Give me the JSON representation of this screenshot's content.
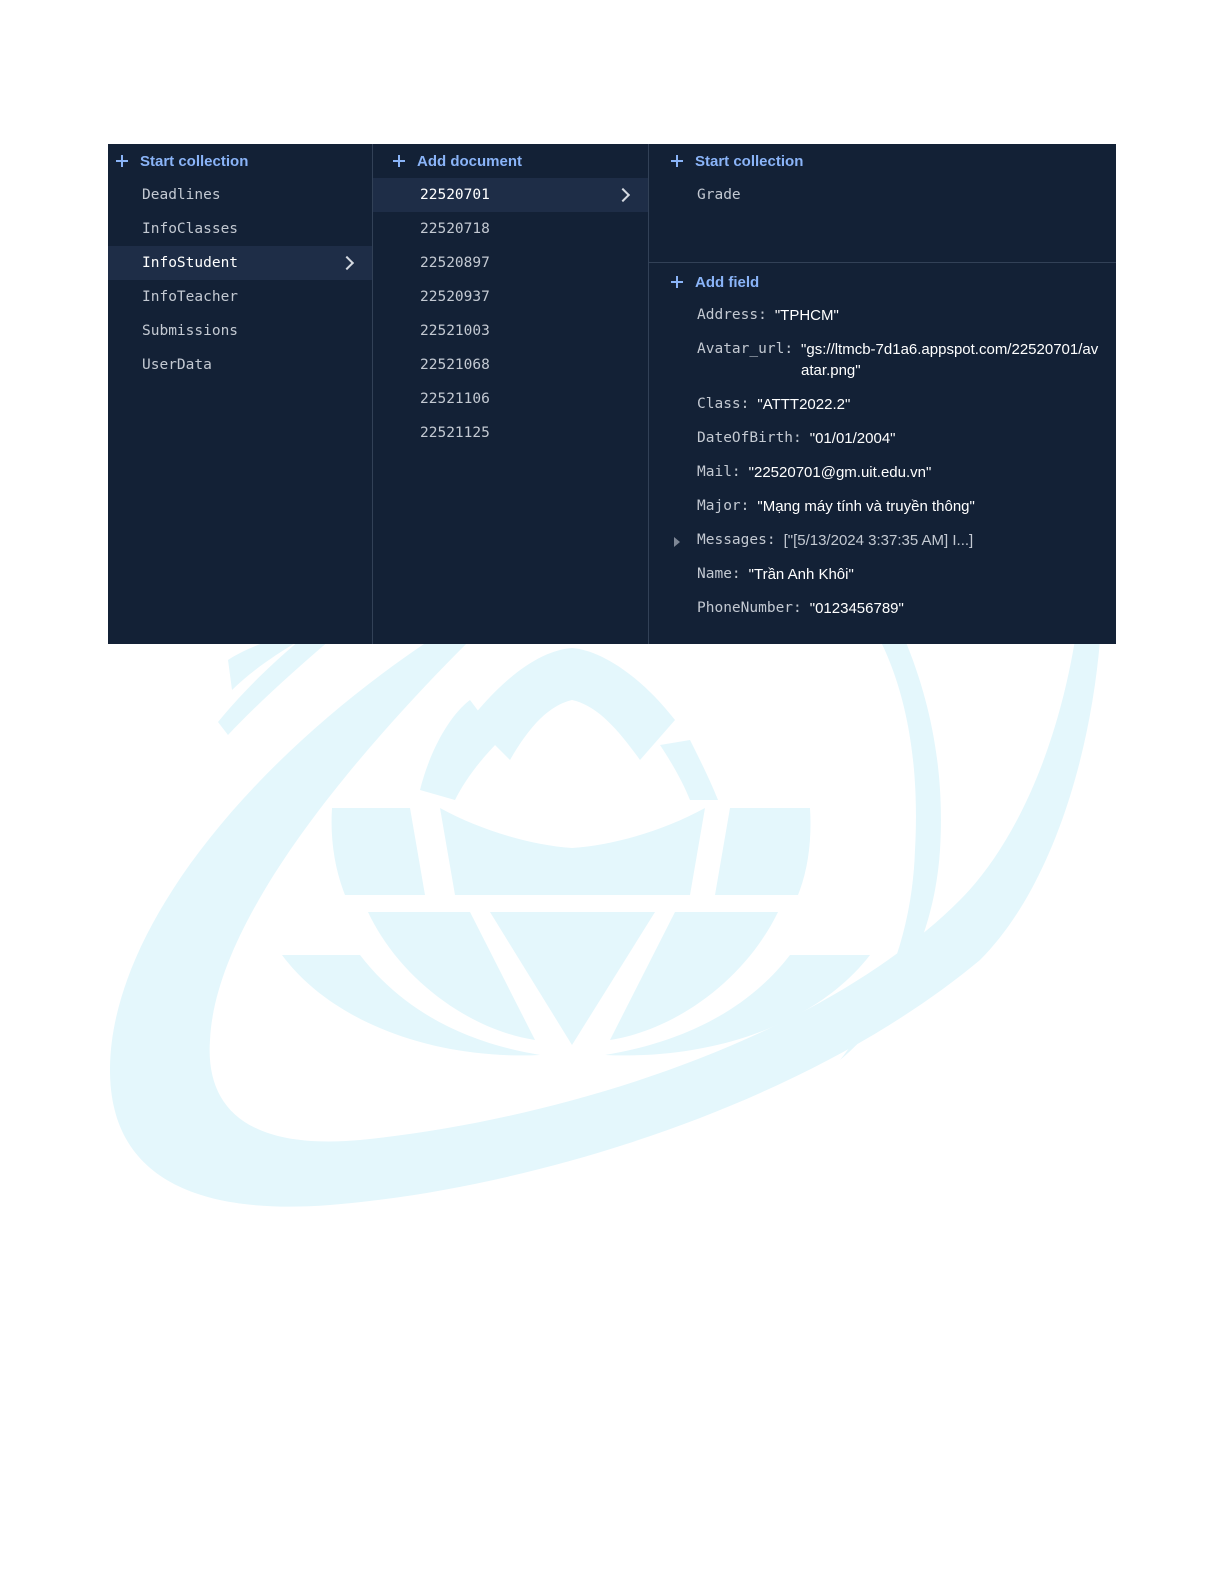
{
  "collections_panel": {
    "start_collection_label": "Start collection",
    "items": [
      {
        "label": "Deadlines"
      },
      {
        "label": "InfoClasses"
      },
      {
        "label": "InfoStudent"
      },
      {
        "label": "InfoTeacher"
      },
      {
        "label": "Submissions"
      },
      {
        "label": "UserData"
      }
    ],
    "selected_index": 2
  },
  "documents_panel": {
    "add_document_label": "Add document",
    "items": [
      {
        "label": "22520701"
      },
      {
        "label": "22520718"
      },
      {
        "label": "22520897"
      },
      {
        "label": "22520937"
      },
      {
        "label": "22521003"
      },
      {
        "label": "22521068"
      },
      {
        "label": "22521106"
      },
      {
        "label": "22521125"
      }
    ],
    "selected_index": 0
  },
  "detail_panel": {
    "start_collection_label": "Start collection",
    "subcollections": [
      {
        "label": "Grade"
      }
    ],
    "add_field_label": "Add field",
    "fields": [
      {
        "key": "Address",
        "value": "\"TPHCM\""
      },
      {
        "key": "Avatar_url",
        "value": "\"gs://ltmcb-7d1a6.appspot.com/22520701/avatar.png\""
      },
      {
        "key": "Class",
        "value": "\"ATTT2022.2\""
      },
      {
        "key": "DateOfBirth",
        "value": "\"01/01/2004\""
      },
      {
        "key": "Mail",
        "value": "\"22520701@gm.uit.edu.vn\""
      },
      {
        "key": "Major",
        "value": "\"Mạng máy tính và truyền thông\""
      },
      {
        "key": "Messages",
        "value": "[\"[5/13/2024 3:37:35 AM] I...]"
      },
      {
        "key": "Name",
        "value": "\"Trần Anh Khôi\""
      },
      {
        "key": "PhoneNumber",
        "value": "\"0123456789\""
      }
    ]
  },
  "colors": {
    "panel_bg": "#132136",
    "selected_bg": "#1e2d47",
    "accent": "#8ab4f8",
    "watermark": "#e4f7fc"
  },
  "icons": [
    "plus-icon",
    "chevron-right-icon",
    "expand-arrow-icon"
  ]
}
